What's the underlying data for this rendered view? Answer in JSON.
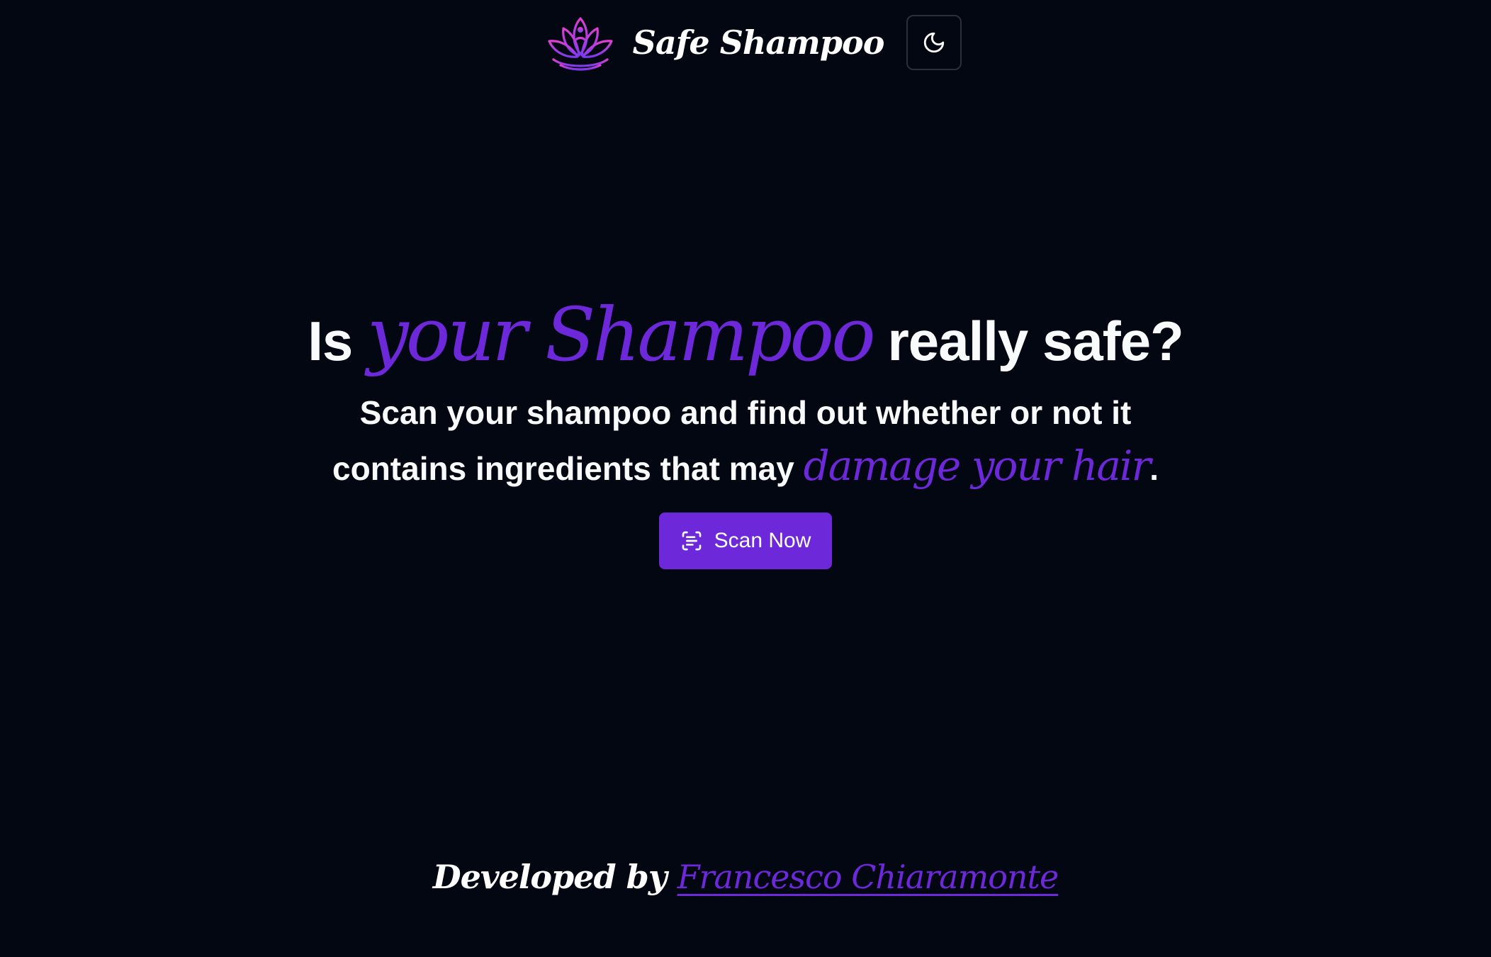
{
  "header": {
    "brand_name": "Safe Shampoo",
    "logo_icon": "lotus-icon",
    "theme_toggle_icon": "moon-icon"
  },
  "hero": {
    "title_prefix": "Is",
    "title_accent": "your Shampoo",
    "title_suffix": "really safe?",
    "subtitle_prefix": "Scan your shampoo and find out whether or not it contains ingredients that may",
    "subtitle_accent": "damage your hair",
    "subtitle_suffix": ".",
    "cta_label": "Scan Now",
    "cta_icon": "scan-text-icon"
  },
  "footer": {
    "prefix": "Developed by",
    "author": "Francesco Chiaramonte"
  },
  "colors": {
    "background": "#030712",
    "accent": "#6d28d9",
    "logo_pink": "#d946ef",
    "logo_purple": "#7c3aed",
    "text": "#f9fafb"
  }
}
